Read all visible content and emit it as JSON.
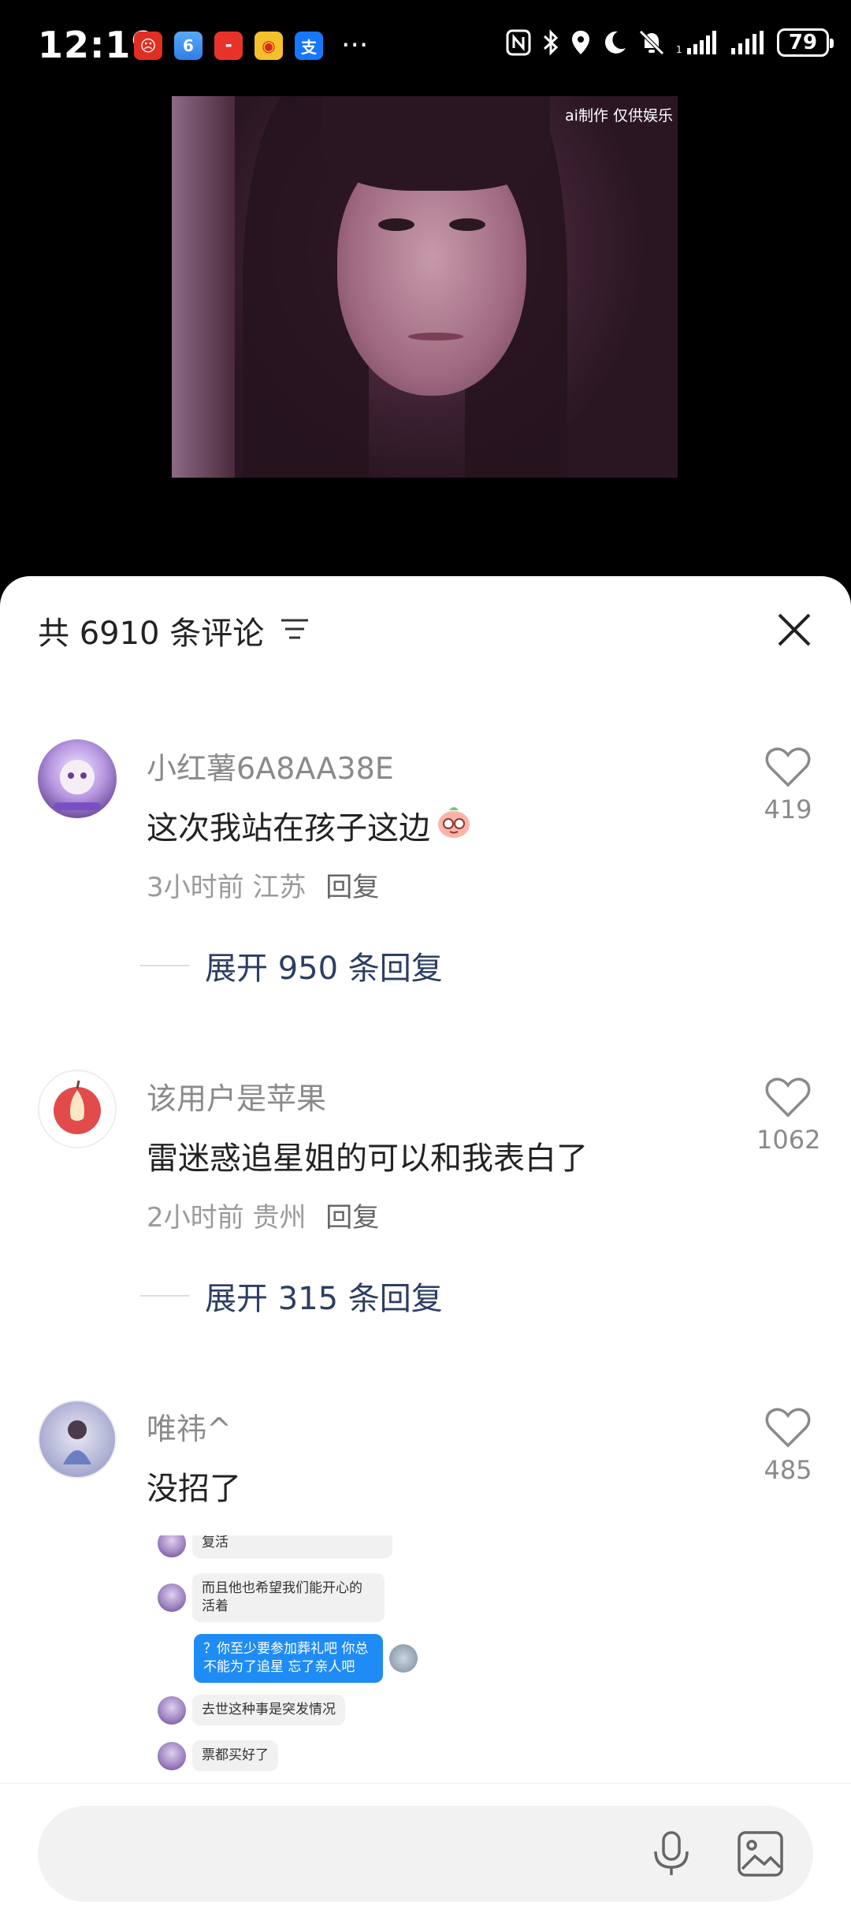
{
  "status_bar": {
    "time": "12:19",
    "battery": "79",
    "app_icons": [
      "pdd-icon",
      "blue-app-icon",
      "huawei-icon",
      "weibo-icon",
      "alipay-icon"
    ],
    "more": "···"
  },
  "video": {
    "watermark": "ai制作 仅供娱乐"
  },
  "comments_panel": {
    "title": "共 6910 条评论",
    "comments": [
      {
        "username": "小红薯6A8AA38E",
        "text": "这次我站在孩子这边",
        "time": "3小时前",
        "location": "江苏",
        "reply": "回复",
        "likes": "419",
        "expand": "展开 950 条回复"
      },
      {
        "username": "该用户是苹果",
        "text": "雷迷惑追星姐的可以和我表白了",
        "time": "2小时前",
        "location": "贵州",
        "reply": "回复",
        "likes": "1062",
        "expand": "展开 315 条回复"
      },
      {
        "username": "唯祎^",
        "text": "没招了",
        "likes": "485"
      }
    ],
    "chat_image": {
      "messages": [
        "复活",
        "而且他也希望我们能开心的活着",
        "？你至少要参加葬礼吧  你总不能为了追星 忘了亲人吧",
        "去世这种事是突发情况",
        "票都买好了"
      ]
    }
  },
  "colors": {
    "accent_link": "#2c3e63",
    "chat_blue": "#1f8cf5"
  }
}
